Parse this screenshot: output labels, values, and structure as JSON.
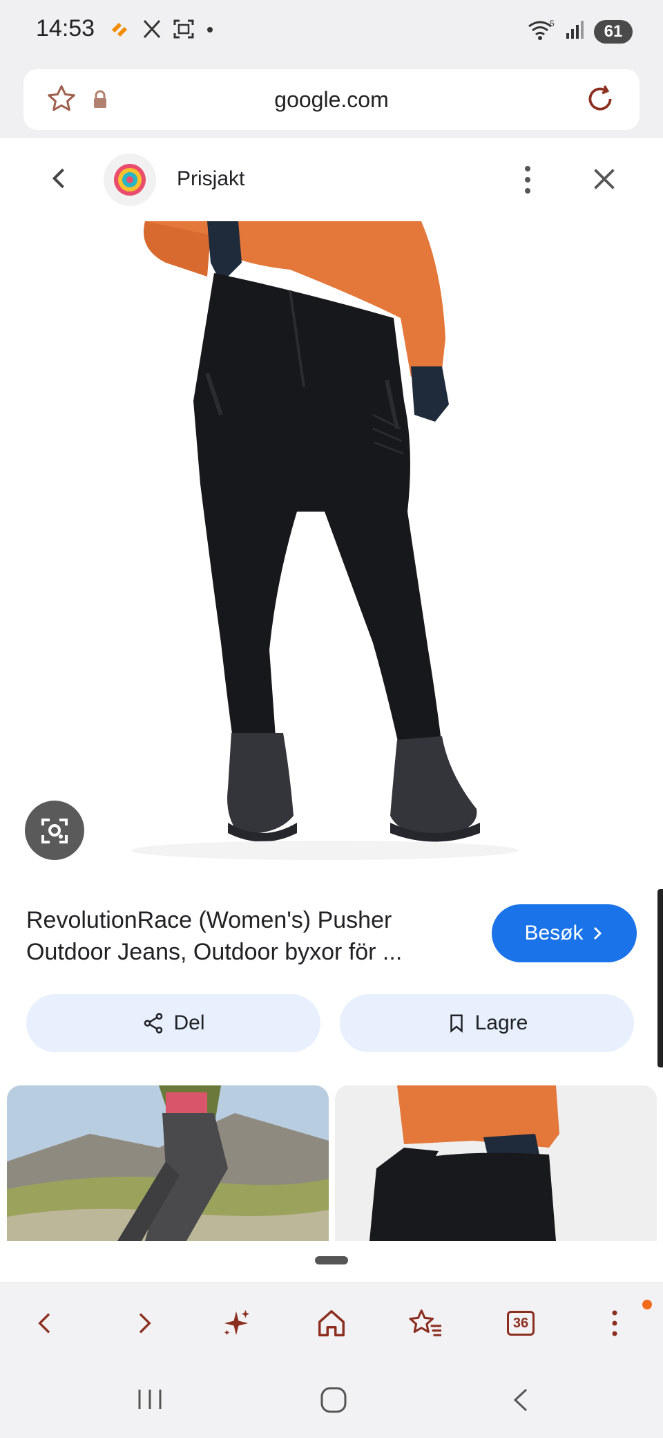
{
  "status_bar": {
    "time": "14:53",
    "battery": "61",
    "icons": [
      "strava-icon",
      "x-icon",
      "screenshot-icon",
      "dot-icon",
      "wifi-icon",
      "signal-icon",
      "battery-icon"
    ]
  },
  "url_bar": {
    "url": "google.com",
    "icons": [
      "star-icon",
      "lock-icon",
      "reload-icon"
    ]
  },
  "sheet_header": {
    "site_name": "Prisjakt",
    "icons": [
      "back-icon",
      "prisjakt-logo-icon",
      "more-vert-icon",
      "close-icon"
    ]
  },
  "product": {
    "title": "RevolutionRace (Women's) Pusher Outdoor Jeans, Outdoor byxor för ...",
    "visit_label": "Besøk",
    "share_label": "Del",
    "save_label": "Lagre"
  },
  "toolbar": {
    "tab_count": "36",
    "icons": [
      "back-arrow-icon",
      "forward-arrow-icon",
      "sparkle-icon",
      "home-icon",
      "bookmarks-icon",
      "tabs-icon",
      "menu-icon"
    ]
  },
  "navbar": {
    "icons": [
      "recent-apps-icon",
      "home-button-icon",
      "back-nav-icon"
    ]
  },
  "colors": {
    "accent_blue": "#1a73e8",
    "chip_bg": "#e8f0fe",
    "toolbar_icon": "#8c2e1f",
    "badge_orange": "#f26b1d"
  }
}
